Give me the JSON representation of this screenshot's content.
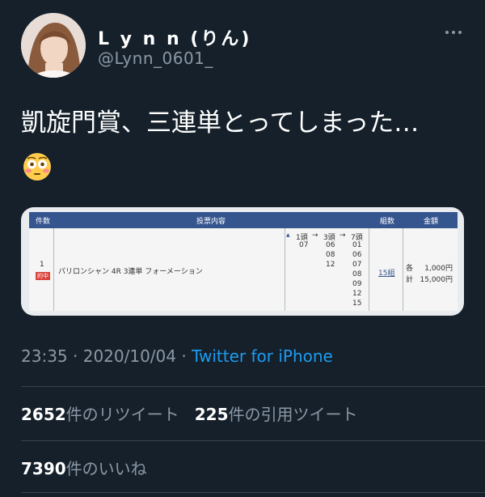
{
  "author": {
    "name": "L y n n (りん)",
    "handle": "@Lynn_0601_"
  },
  "tweet": {
    "text": "凱旋門賞、三連単とってしまった…",
    "emoji": "flushed-face-emoji"
  },
  "ticket": {
    "headers": {
      "count": "件数",
      "content": "投票内容",
      "combos": "組数",
      "amount": "金額"
    },
    "row_no": "1",
    "badge": "的中",
    "race": "パリロンシャン 4R 3連単 フォーメーション",
    "pos1_label": "1頭",
    "pos2_label": "3頭",
    "pos3_label": "7頭",
    "pos1": [
      "07"
    ],
    "pos2": [
      "06",
      "08",
      "12"
    ],
    "pos3": [
      "01",
      "06",
      "07",
      "08",
      "09",
      "12",
      "15"
    ],
    "combo_count": "15組",
    "each_label": "各",
    "each_value": "1,000円",
    "total_label": "計",
    "total_value": "15,000円"
  },
  "meta": {
    "time": "23:35",
    "date": "2020/10/04",
    "sep": "·",
    "source": "Twitter for iPhone"
  },
  "stats": {
    "retweets": "2652",
    "retweets_label": "件のリツイート",
    "quotes": "225",
    "quotes_label": "件の引用ツイート",
    "likes": "7390",
    "likes_label": "件のいいね"
  },
  "colors": {
    "background": "#15202b",
    "secondary_text": "#8b98a5",
    "link": "#1d9bf0",
    "ticket_header": "#35558f",
    "badge": "#d8423a"
  }
}
